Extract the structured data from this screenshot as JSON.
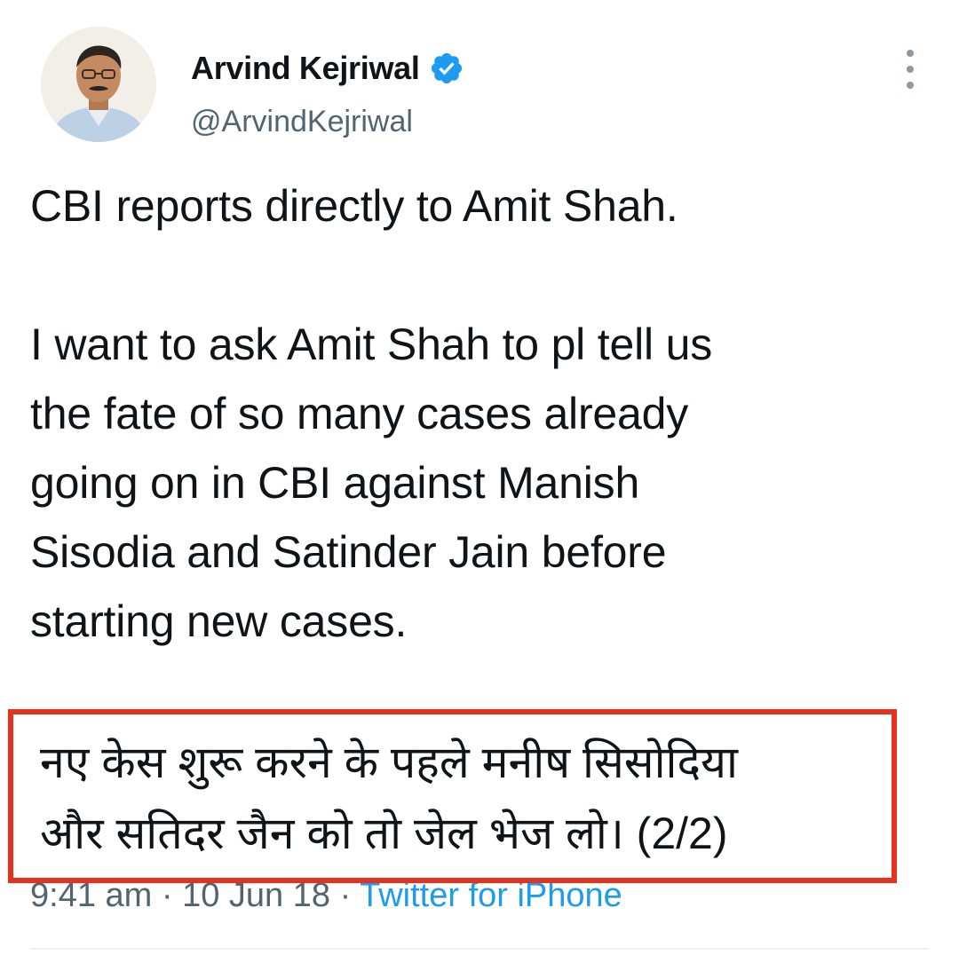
{
  "author": {
    "name": "Arvind Kejriwal",
    "handle": "@ArvindKejriwal",
    "verified": true,
    "verified_icon": "verified-badge-icon",
    "verified_color": "#1d9bf0"
  },
  "more_icon": "more-vertical-icon",
  "tweet": {
    "paragraph1": "CBI reports directly to Amit Shah.",
    "paragraph2_lines": [
      "I want to ask Amit Shah to pl tell us",
      "the fate of so many cases already",
      "going on in CBI against Manish",
      "Sisodia and Satinder Jain before",
      "starting new cases."
    ],
    "hindi_lines": [
      "नए केस शुरू करने के पहले मनीष सिसोदिया",
      "और सतिदर जैन को तो जेल भेज लो। (2/2)"
    ]
  },
  "meta": {
    "time": "9:41 am",
    "separator": "·",
    "date": "10 Jun 18",
    "source": "Twitter for iPhone"
  },
  "colors": {
    "highlight_border": "#e8311d",
    "link": "#1d9bf0",
    "secondary_text": "#536471"
  }
}
